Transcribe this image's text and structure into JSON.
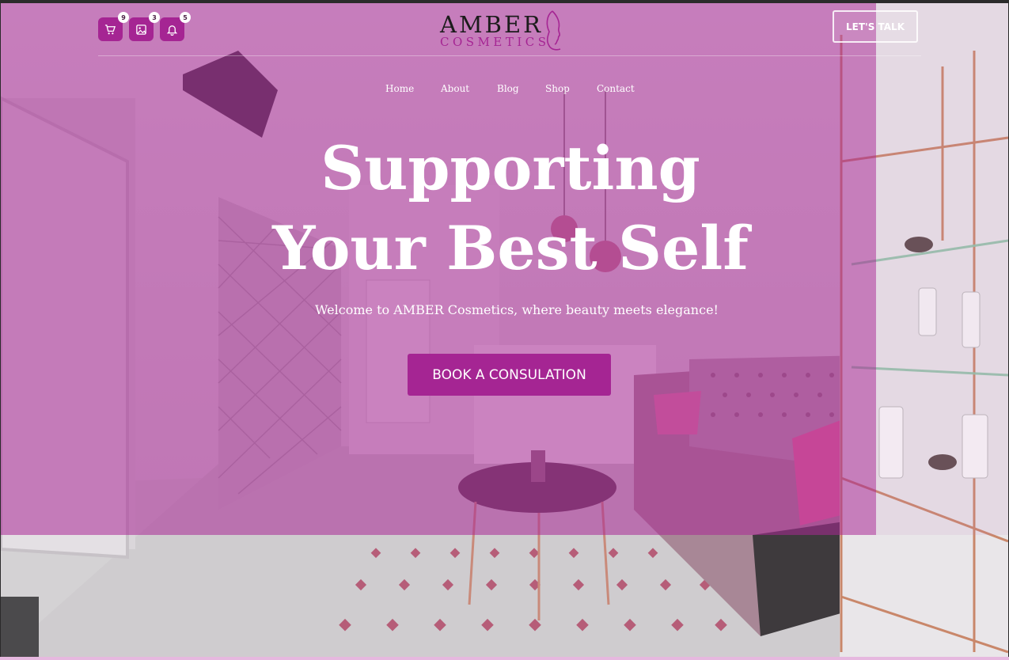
{
  "header": {
    "icons": [
      {
        "name": "cart-icon",
        "count": "9"
      },
      {
        "name": "image-icon",
        "count": "3"
      },
      {
        "name": "bell-icon",
        "count": "5"
      }
    ],
    "logo": {
      "main": "AMBER",
      "sub": "COSMETICS"
    },
    "cta_label": "LET'S TALK"
  },
  "nav": {
    "items": [
      "Home",
      "About",
      "Blog",
      "Shop",
      "Contact"
    ]
  },
  "hero": {
    "title_line1": "Supporting",
    "title_line2": "Your Best Self",
    "subtitle": "Welcome to AMBER Cosmetics, where beauty meets elegance!",
    "button_label": "BOOK A CONSULATION"
  },
  "colors": {
    "brand": "#a52593",
    "overlay": "rgba(170, 40, 150, 0.55)",
    "text_light": "#ffffff"
  }
}
